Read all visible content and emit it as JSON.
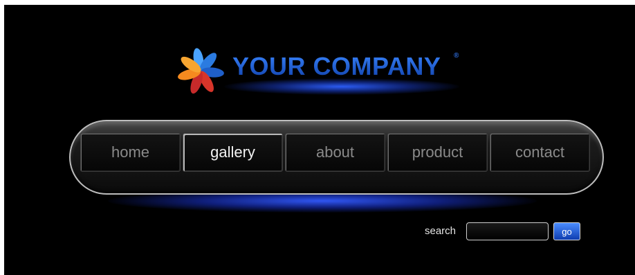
{
  "brand": {
    "name": "YOUR COMPANY",
    "trademark": "®",
    "logo_icon": "pinwheel-flower-logo",
    "colors": {
      "brand_blue": "#1f5fd6",
      "glow_blue": "#2d5fff"
    }
  },
  "nav": {
    "items": [
      {
        "label": "home",
        "active": false
      },
      {
        "label": "gallery",
        "active": true
      },
      {
        "label": "about",
        "active": false
      },
      {
        "label": "product",
        "active": false
      },
      {
        "label": "contact",
        "active": false
      }
    ]
  },
  "search": {
    "label": "search",
    "value": "",
    "button_label": "go"
  },
  "theme": {
    "background": "#000000",
    "active_text": "#f2f2f2",
    "inactive_text": "#8a8a8a",
    "button_blue": "#2a6aff"
  }
}
